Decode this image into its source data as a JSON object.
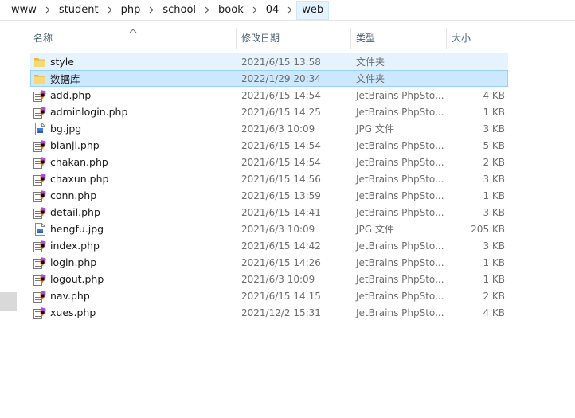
{
  "breadcrumb": [
    "www",
    "student",
    "php",
    "school",
    "book",
    "04",
    "web"
  ],
  "columns": {
    "name": "名称",
    "date": "修改日期",
    "type": "类型",
    "size": "大小"
  },
  "files": [
    {
      "name": "style",
      "date": "2021/6/15 13:58",
      "type": "文件夹",
      "size": "",
      "icon": "folder-icon",
      "state": "hover"
    },
    {
      "name": "数据库",
      "date": "2022/1/29 20:34",
      "type": "文件夹",
      "size": "",
      "icon": "folder-icon",
      "state": "selected"
    },
    {
      "name": "add.php",
      "date": "2021/6/15 14:54",
      "type": "JetBrains PhpSto...",
      "size": "4 KB",
      "icon": "phpstorm-file-icon",
      "state": ""
    },
    {
      "name": "adminlogin.php",
      "date": "2021/6/15 14:25",
      "type": "JetBrains PhpSto...",
      "size": "1 KB",
      "icon": "phpstorm-file-icon",
      "state": ""
    },
    {
      "name": "bg.jpg",
      "date": "2021/6/3 10:09",
      "type": "JPG 文件",
      "size": "3 KB",
      "icon": "image-file-icon",
      "state": ""
    },
    {
      "name": "bianji.php",
      "date": "2021/6/15 14:54",
      "type": "JetBrains PhpSto...",
      "size": "5 KB",
      "icon": "phpstorm-file-icon",
      "state": ""
    },
    {
      "name": "chakan.php",
      "date": "2021/6/15 14:54",
      "type": "JetBrains PhpSto...",
      "size": "2 KB",
      "icon": "phpstorm-file-icon",
      "state": ""
    },
    {
      "name": "chaxun.php",
      "date": "2021/6/15 14:56",
      "type": "JetBrains PhpSto...",
      "size": "3 KB",
      "icon": "phpstorm-file-icon",
      "state": ""
    },
    {
      "name": "conn.php",
      "date": "2021/6/15 13:59",
      "type": "JetBrains PhpSto...",
      "size": "1 KB",
      "icon": "phpstorm-file-icon",
      "state": ""
    },
    {
      "name": "detail.php",
      "date": "2021/6/15 14:41",
      "type": "JetBrains PhpSto...",
      "size": "3 KB",
      "icon": "phpstorm-file-icon",
      "state": ""
    },
    {
      "name": "hengfu.jpg",
      "date": "2021/6/3 10:09",
      "type": "JPG 文件",
      "size": "205 KB",
      "icon": "image-file-icon",
      "state": ""
    },
    {
      "name": "index.php",
      "date": "2021/6/15 14:42",
      "type": "JetBrains PhpSto...",
      "size": "3 KB",
      "icon": "phpstorm-file-icon",
      "state": ""
    },
    {
      "name": "login.php",
      "date": "2021/6/15 14:26",
      "type": "JetBrains PhpSto...",
      "size": "1 KB",
      "icon": "phpstorm-file-icon",
      "state": ""
    },
    {
      "name": "logout.php",
      "date": "2021/6/3 10:09",
      "type": "JetBrains PhpSto...",
      "size": "1 KB",
      "icon": "phpstorm-file-icon",
      "state": ""
    },
    {
      "name": "nav.php",
      "date": "2021/6/15 14:15",
      "type": "JetBrains PhpSto...",
      "size": "2 KB",
      "icon": "phpstorm-file-icon",
      "state": ""
    },
    {
      "name": "xues.php",
      "date": "2021/12/2 15:31",
      "type": "JetBrains PhpSto...",
      "size": "4 KB",
      "icon": "phpstorm-file-icon",
      "state": ""
    }
  ],
  "colors": {
    "folder": "#f8d775",
    "selection": "#cce8ff",
    "hover": "#e5f3ff",
    "header_text": "#4c607a",
    "phpstorm_accent": "#b345f1"
  }
}
